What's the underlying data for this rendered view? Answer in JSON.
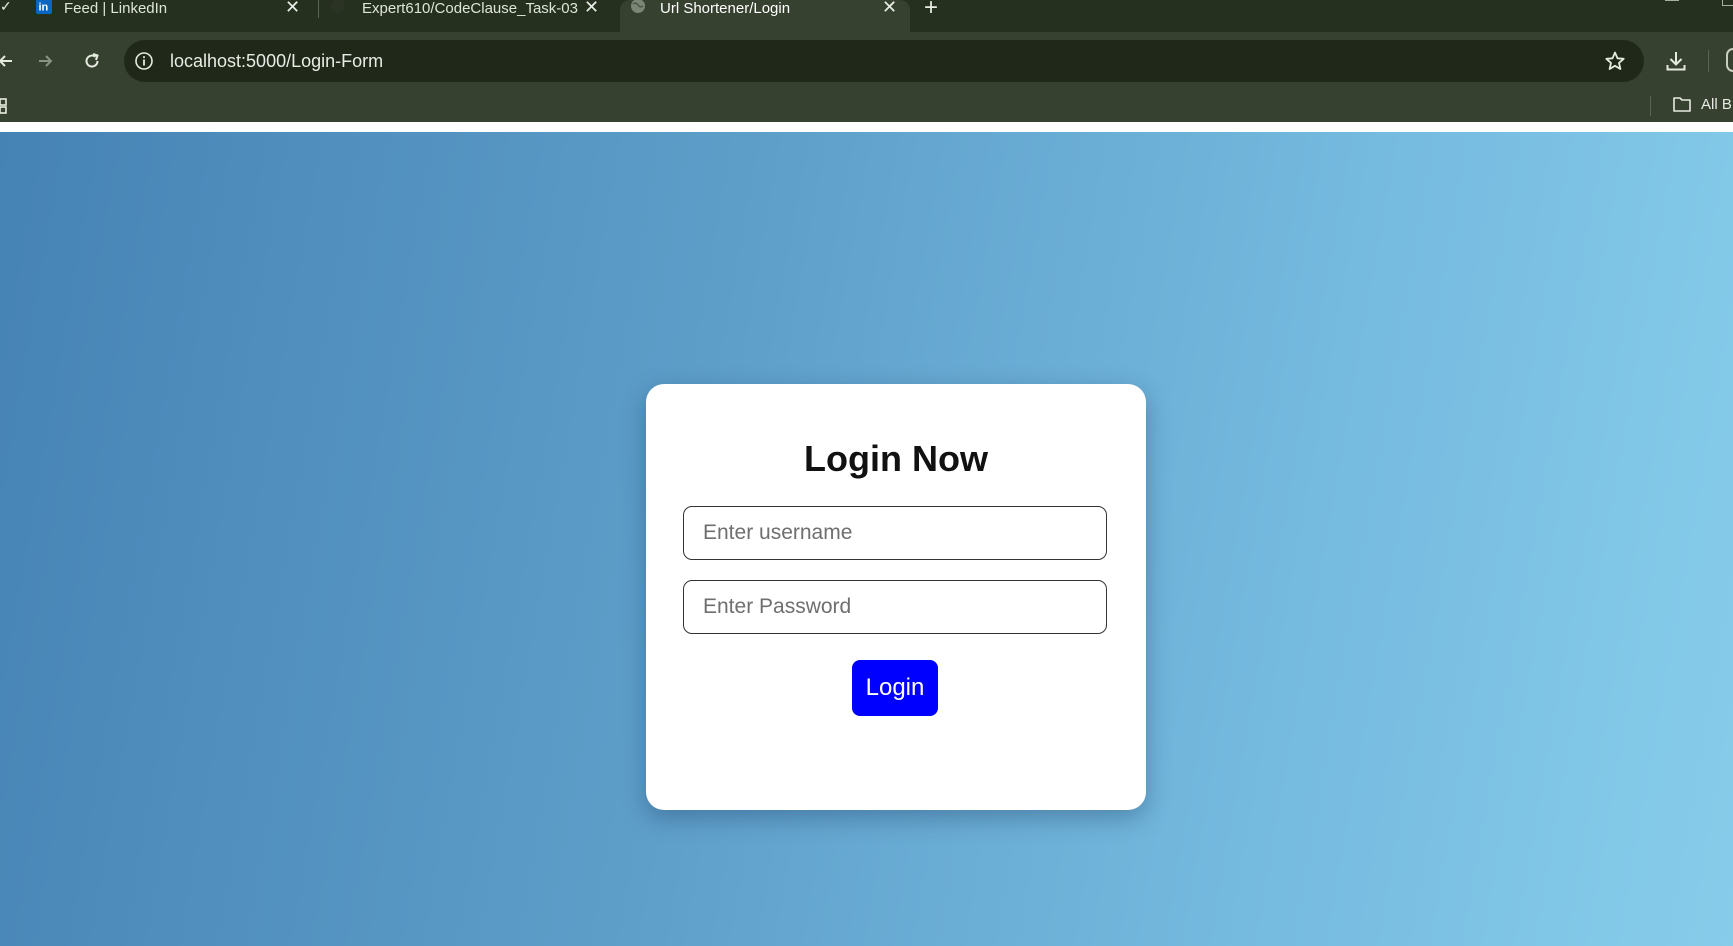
{
  "browser": {
    "tabs": [
      {
        "title": "Feed | LinkedIn",
        "icon": "linkedin-icon",
        "active": false
      },
      {
        "title": "Expert610/CodeClause_Task-03",
        "icon": "github-icon",
        "active": false
      },
      {
        "title": "Url Shortener/Login",
        "icon": "globe-icon",
        "active": true
      }
    ],
    "address_bar": {
      "url": "localhost:5000/Login-Form"
    },
    "bookmarks_bar": {
      "all_bookmarks_label": "All B"
    },
    "accent_color": "#374130"
  },
  "page": {
    "title": "Login Now",
    "username_field": {
      "placeholder": "Enter username",
      "value": ""
    },
    "password_field": {
      "placeholder": "Enter Password",
      "value": ""
    },
    "login_button": {
      "label": "Login",
      "color": "#0000ff"
    },
    "background_gradient": [
      "#4683b5",
      "#87cdea"
    ]
  }
}
